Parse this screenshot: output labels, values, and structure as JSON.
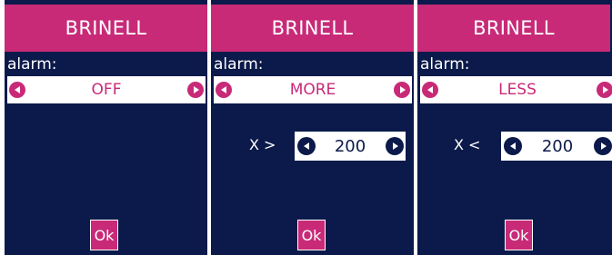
{
  "colors": {
    "background": "#0b1a4a",
    "accent": "#c82a78",
    "panel": "#ffffff"
  },
  "screens": [
    {
      "title": "BRINELL",
      "alarm_label": "alarm:",
      "alarm_value": "OFF",
      "ok_label": "Ok",
      "left_icon": "chevron-left-circle-icon",
      "right_icon": "chevron-right-circle-icon"
    },
    {
      "title": "BRINELL",
      "alarm_label": "alarm:",
      "alarm_value": "MORE",
      "threshold_label": "X >",
      "threshold_value": "200",
      "ok_label": "Ok",
      "left_icon": "chevron-left-circle-icon",
      "right_icon": "chevron-right-circle-icon"
    },
    {
      "title": "BRINELL",
      "alarm_label": "alarm:",
      "alarm_value": "LESS",
      "threshold_label": "X <",
      "threshold_value": "200",
      "ok_label": "Ok",
      "left_icon": "chevron-left-circle-icon",
      "right_icon": "chevron-right-circle-icon"
    }
  ]
}
